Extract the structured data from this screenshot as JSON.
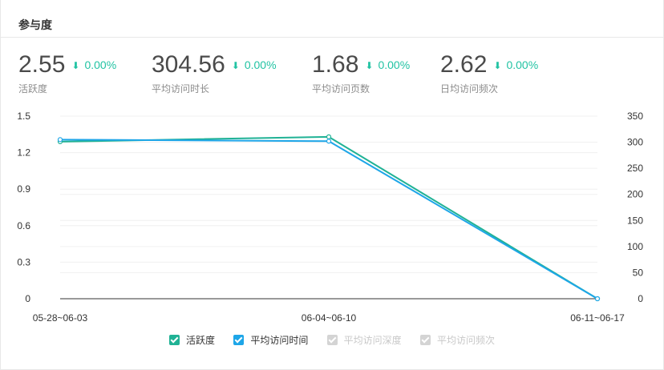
{
  "card": {
    "title": "参与度"
  },
  "kpis": [
    {
      "value": "2.55",
      "trend": "0.00%",
      "label": "活跃度"
    },
    {
      "value": "304.56",
      "trend": "0.00%",
      "label": "平均访问时长"
    },
    {
      "value": "1.68",
      "trend": "0.00%",
      "label": "平均访问页数"
    },
    {
      "value": "2.62",
      "trend": "0.00%",
      "label": "日均访问频次"
    }
  ],
  "colors": {
    "series_active": "#20b295",
    "series_time": "#1ea6e8",
    "legend_off": "#d4d4d4",
    "trend_down": "#22c3a3"
  },
  "icons": {
    "trend": "arrow-down-icon",
    "legend_on": "checkbox-checked-icon",
    "legend_off": "checkbox-checked-icon"
  },
  "chart_data": {
    "type": "line",
    "categories": [
      "05-28~06-03",
      "06-04~06-10",
      "06-11~06-17"
    ],
    "y_left": {
      "ticks": [
        "0",
        "0.3",
        "0.6",
        "0.9",
        "1.2",
        "1.5"
      ],
      "ylim": [
        0,
        1.5
      ]
    },
    "y_right": {
      "ticks": [
        "0",
        "50",
        "100",
        "150",
        "200",
        "250",
        "300",
        "350"
      ],
      "ylim": [
        0,
        350
      ]
    },
    "grid": true,
    "series": [
      {
        "name": "活跃度",
        "axis": "left",
        "values": [
          1.29,
          1.33,
          0
        ]
      },
      {
        "name": "平均访问时间",
        "axis": "right",
        "values": [
          305,
          302,
          0
        ]
      }
    ],
    "legend": [
      {
        "label": "活跃度",
        "enabled": true
      },
      {
        "label": "平均访问时间",
        "enabled": true
      },
      {
        "label": "平均访问深度",
        "enabled": false
      },
      {
        "label": "平均访问频次",
        "enabled": false
      }
    ],
    "legend_position": "bottom"
  }
}
